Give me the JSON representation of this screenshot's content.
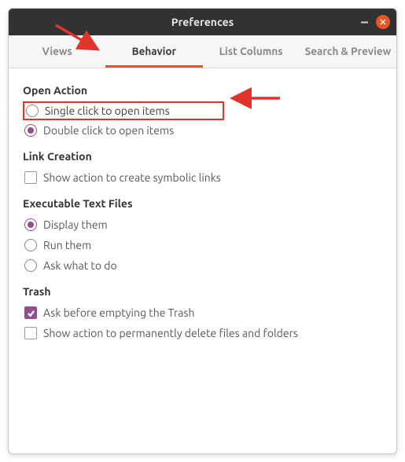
{
  "window": {
    "title": "Preferences"
  },
  "tabs": {
    "views": "Views",
    "behavior": "Behavior",
    "list_columns": "List Columns",
    "search_preview": "Search & Preview"
  },
  "sections": {
    "open_action": {
      "title": "Open Action",
      "single_click": "Single click to open items",
      "double_click": "Double click to open items"
    },
    "link_creation": {
      "title": "Link Creation",
      "symbolic": "Show action to create symbolic links"
    },
    "exec_files": {
      "title": "Executable Text Files",
      "display": "Display them",
      "run": "Run them",
      "ask": "Ask what to do"
    },
    "trash": {
      "title": "Trash",
      "ask_empty": "Ask before emptying the Trash",
      "perm_delete": "Show action to permanently delete files and folders"
    }
  }
}
